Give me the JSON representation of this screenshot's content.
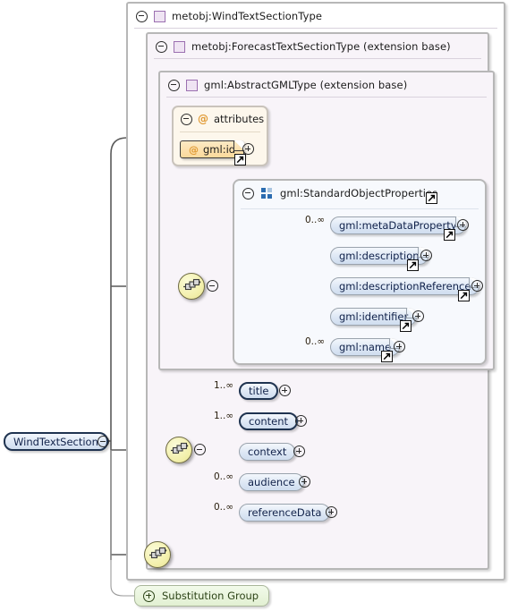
{
  "diagram": {
    "kind": "xml-schema-element-diagram",
    "root_element": {
      "name": "WindTextSection",
      "required": true
    },
    "substitution_group": {
      "label": "Substitution Group",
      "toggle": "plus"
    },
    "containers": [
      {
        "id": "c0",
        "title": "metobj:WindTextSectionType",
        "icon": "complex-type-icon",
        "toggle": "minus"
      },
      {
        "id": "c1",
        "title": "metobj:ForecastTextSectionType (extension base)",
        "icon": "complex-type-icon",
        "toggle": "minus"
      },
      {
        "id": "c2",
        "title": "gml:AbstractGMLType (extension base)",
        "icon": "complex-type-icon",
        "toggle": "minus"
      }
    ],
    "attributes_panel": {
      "title": "attributes",
      "icon": "attribute-icon",
      "toggle": "minus",
      "items": [
        {
          "name": "gml:id",
          "icon": "attribute-icon",
          "toggle": "plus",
          "link": true,
          "folded": true
        }
      ]
    },
    "group": {
      "title": "gml:StandardObjectProperties",
      "icon": "model-group-icon",
      "toggle": "minus",
      "link": true,
      "compositor": "sequence",
      "children": [
        {
          "name": "gml:metaDataProperty",
          "cardinality": "0..∞",
          "required": false,
          "link": true,
          "toggle": "plus"
        },
        {
          "name": "gml:description",
          "cardinality": "",
          "required": false,
          "link": true,
          "toggle": "plus"
        },
        {
          "name": "gml:descriptionReference",
          "cardinality": "",
          "required": false,
          "link": true,
          "toggle": "plus"
        },
        {
          "name": "gml:identifier",
          "cardinality": "",
          "required": false,
          "link": true,
          "toggle": "plus"
        },
        {
          "name": "gml:name",
          "cardinality": "0..∞",
          "required": false,
          "link": true,
          "toggle": "plus"
        }
      ]
    },
    "local_sequence": {
      "compositor": "sequence",
      "toggle": "minus",
      "children": [
        {
          "name": "title",
          "cardinality": "1..∞",
          "required": true,
          "toggle": "plus"
        },
        {
          "name": "content",
          "cardinality": "1..∞",
          "required": true,
          "toggle": "plus"
        },
        {
          "name": "context",
          "cardinality": "",
          "required": false,
          "toggle": "plus"
        },
        {
          "name": "audience",
          "cardinality": "0..∞",
          "required": false,
          "toggle": "plus"
        },
        {
          "name": "referenceData",
          "cardinality": "0..∞",
          "required": false,
          "toggle": "plus"
        }
      ]
    },
    "extra_sequence": {
      "compositor": "sequence"
    },
    "colors": {
      "container_border": "#b7b7b7",
      "container_fill_nested": "#f8f4f9",
      "element_fill": "#dee8f5",
      "element_border_required": "#1f3350",
      "element_border_optional": "#9aa3ad",
      "attribute_fill": "#fbd99b",
      "attribute_accent": "#e09a34",
      "type_icon": "#9b6fb0",
      "group_icon": "#2b6cb0",
      "compositor_fill": "#f3f0ac",
      "substitution_fill": "#e2f0d2",
      "wire": "#5a5a5a"
    }
  }
}
